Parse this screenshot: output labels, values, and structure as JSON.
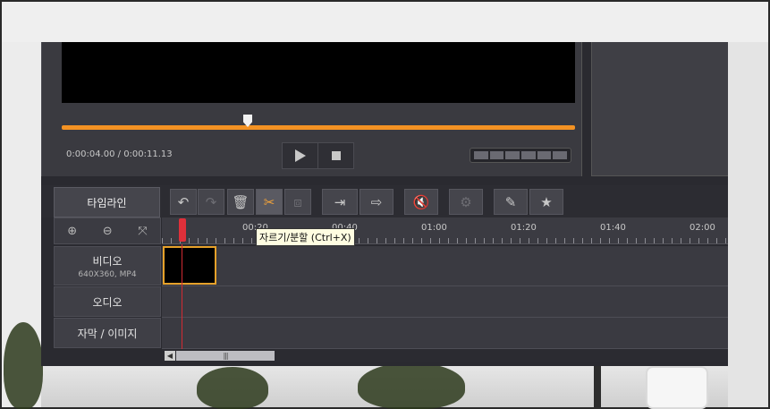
{
  "preview": {
    "time_current": "0:00:04.00",
    "time_separator": " / ",
    "time_total": "0:00:11.13",
    "progress_percent": 36,
    "accent_color": "#f39223"
  },
  "toolbar": {
    "timeline_tab": "타임라인",
    "undo_icon": "undo-arrow",
    "redo_icon": "redo-arrow",
    "delete_icon": "trash-can",
    "cut_icon": "scissors",
    "crop_icon": "crop-x",
    "insert_icon": "insert-clip",
    "export_icon": "export-clip",
    "mute_icon": "speaker-mute",
    "effect_icon": "effect-wand",
    "edit_icon": "film-edit",
    "favorite_icon": "film-star"
  },
  "zoom": {
    "zoom_in_icon": "zoom-in",
    "zoom_out_icon": "zoom-out",
    "fit_icon": "fit-screen"
  },
  "ruler": {
    "labels": [
      "00:20",
      "00:40",
      "01:00",
      "01:20",
      "01:40",
      "02:00"
    ]
  },
  "tooltip": {
    "text": "자르기/분할 (Ctrl+X)"
  },
  "tracks": {
    "video_label": "비디오",
    "video_info": "640X360, MP4",
    "audio_label": "오디오",
    "subtitle_label": "자막 / 이미지"
  },
  "scrollbar": {
    "left_arrow": "◀",
    "grip": "|||"
  }
}
